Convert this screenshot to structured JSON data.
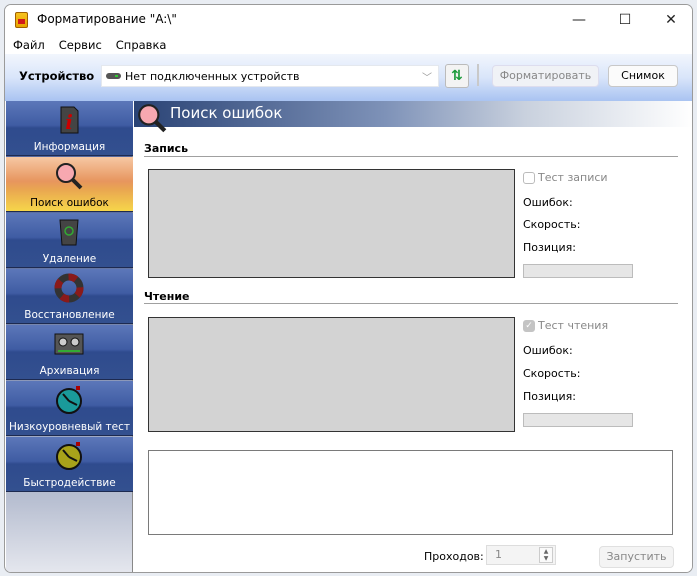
{
  "window": {
    "title": "Форматирование \"A:\\\"",
    "minimize": "—",
    "maximize": "☐",
    "close": "✕"
  },
  "menu": [
    "Файл",
    "Сервис",
    "Справка"
  ],
  "toolbar": {
    "device_label": "Устройство",
    "device_value": "Нет подключенных устройств",
    "format_label": "Форматировать",
    "snapshot_label": "Снимок"
  },
  "sidebar": {
    "items": [
      {
        "label": "Информация",
        "icon": "info-icon"
      },
      {
        "label": "Поиск ошибок",
        "icon": "magnifier-icon",
        "active": true
      },
      {
        "label": "Удаление",
        "icon": "trash-icon"
      },
      {
        "label": "Восстановление",
        "icon": "lifebuoy-icon"
      },
      {
        "label": "Архивация",
        "icon": "cassette-icon"
      },
      {
        "label": "Низкоуровневый тест",
        "icon": "stopwatch-icon"
      },
      {
        "label": "Быстродействие",
        "icon": "stopwatch-icon"
      }
    ]
  },
  "main": {
    "title": "Поиск ошибок",
    "write": {
      "section": "Запись",
      "checkbox": "Тест записи",
      "checked": false,
      "errors": "Ошибок:",
      "speed": "Скорость:",
      "position": "Позиция:"
    },
    "read": {
      "section": "Чтение",
      "checkbox": "Тест чтения",
      "checked": true,
      "errors": "Ошибок:",
      "speed": "Скорость:",
      "position": "Позиция:"
    },
    "passes_label": "Проходов:",
    "passes_value": "1",
    "start_label": "Запустить"
  }
}
